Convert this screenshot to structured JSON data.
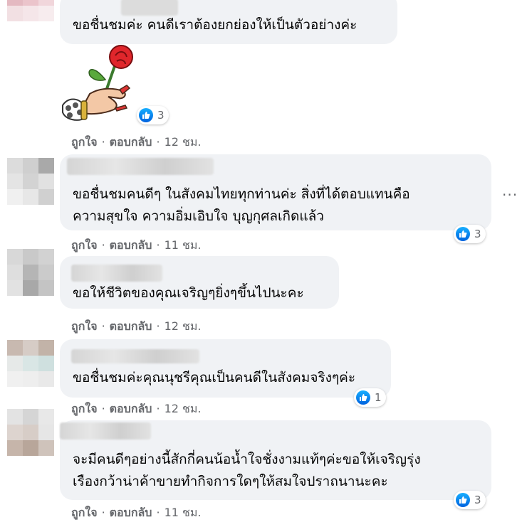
{
  "actions": {
    "like": "ถูกใจ",
    "reply": "ตอบกลับ",
    "dot": "·"
  },
  "comments": [
    {
      "text": "ขอชื่นชมค่ะ คนดีเราต้องยกย่องให้เป็นตัวอย่างค่ะ",
      "time": "12 ชม.",
      "reactions": "3"
    },
    {
      "text1": "ขอชื่นชมคนดีๆ ในสังคมไทยทุกท่านค่ะ สิ่งที่ได้ตอบแทนคือ",
      "text2": "ความสุขใจ ความอิ่มเอิบใจ บุญกุศลเกิดแล้ว",
      "time": "11 ชม.",
      "reactions": "3"
    },
    {
      "text": "ขอให้ชีวิตของคุณเจริญๆยิ่งๆขึ้นไปนะคะ",
      "time": "12 ชม."
    },
    {
      "text": "ขอชื่นชมค่ะคุณนุชรีคุณเป็นคนดีในสังคมจริงๆค่ะ",
      "time": "12 ชม.",
      "reactions": "1"
    },
    {
      "text1": "จะมีคนดีๆอย่างนี้สักกี่คนน้อน้ำใจชั่งงามแท้ๆค่ะขอให้เจริญรุ่ง",
      "text2": "เรืองกว้าน่าค้าขายทำกิจการใดๆให้สมใจปราถนานะคะ",
      "time": "11 ชม.",
      "reactions": "3"
    }
  ],
  "colors": {
    "bubble": "#f0f2f5",
    "meta": "#65676b",
    "like_blue": "#1877f2"
  },
  "icons": {
    "more": "more-horizontal-icon",
    "like": "like-thumb-icon",
    "sticker": "hand-holding-rose-sticker"
  },
  "more_glyph": "···"
}
